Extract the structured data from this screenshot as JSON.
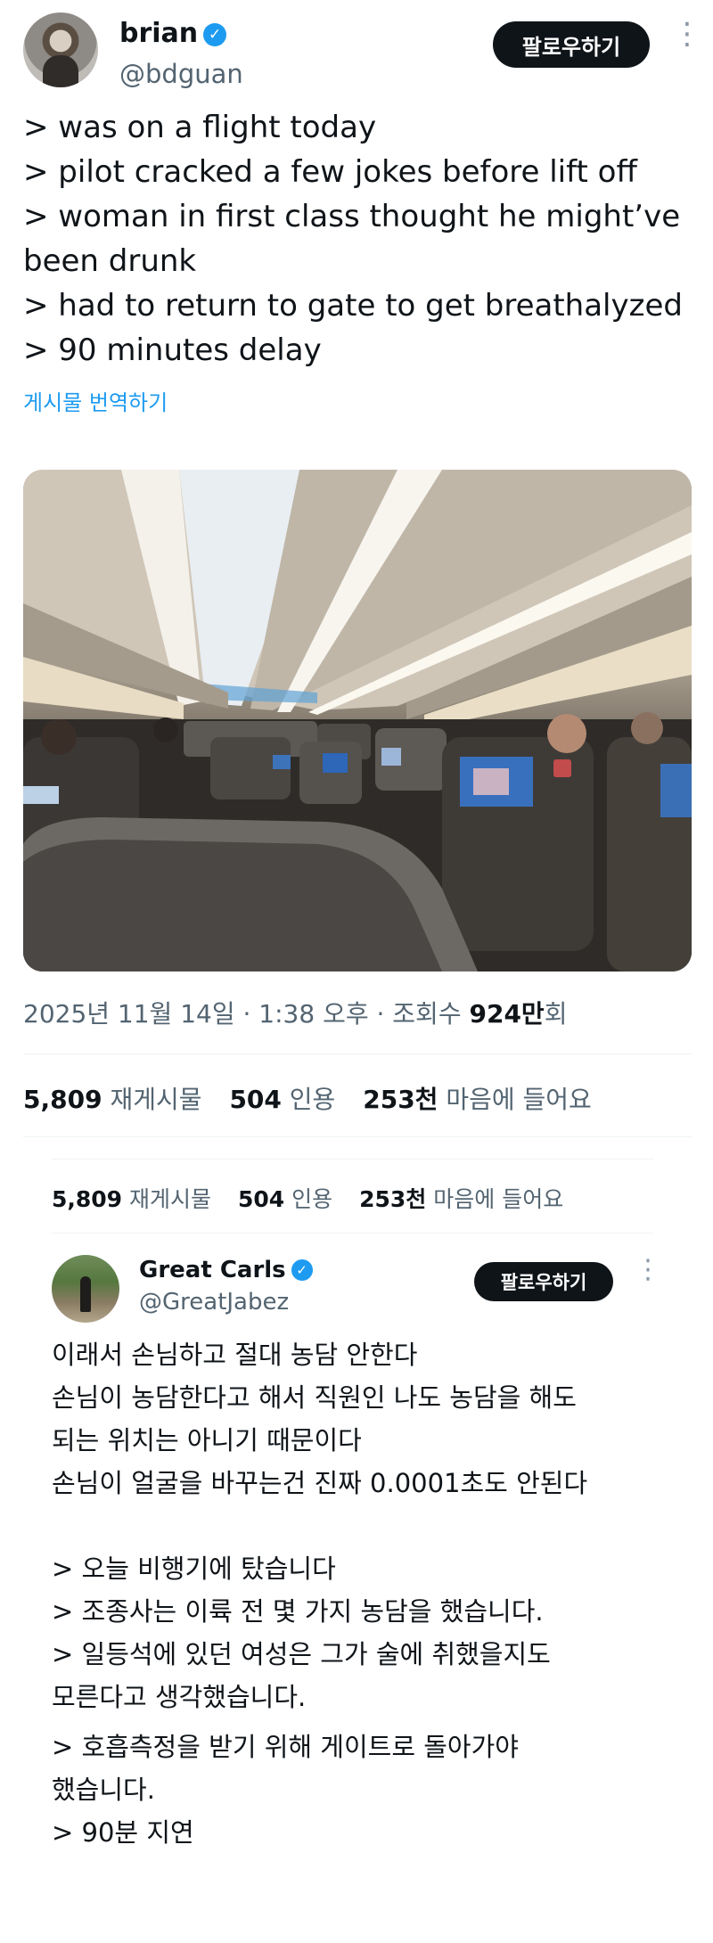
{
  "tweet1": {
    "author_name": "brian",
    "author_handle": "@bdguan",
    "follow_label": "팔로우하기",
    "more_icon": "⋮",
    "lines": [
      "> was on a flight today",
      "> pilot cracked a few jokes before lift off",
      "> woman in first class thought he might’ve been drunk",
      "> had to return to gate to get breathalyzed",
      "> 90 minutes delay"
    ],
    "translate_label": "게시물 번역하기",
    "meta": {
      "date": "2025년 11월 14일 · 1:38 오후 · 조회수 ",
      "views_value": "924만",
      "views_suffix": "회"
    },
    "stats": {
      "reposts_value": "5,809",
      "reposts_label": "재게시물",
      "quotes_value": "504",
      "quotes_label": "인용",
      "likes_value": "253천",
      "likes_label": "마음에 들어요"
    }
  },
  "quoted_stats": {
    "reposts_value": "5,809",
    "reposts_label": "재게시물",
    "quotes_value": "504",
    "quotes_label": "인용",
    "likes_value": "253천",
    "likes_label": "마음에 들어요"
  },
  "tweet2": {
    "author_name": "Great Carls",
    "author_handle": "@GreatJabez",
    "follow_label": "팔로우하기",
    "more_icon": "⋮",
    "paragraph1": [
      "이래서 손님하고 절대 농담 안한다",
      "손님이 농담한다고 해서 직원인 나도 농담을 해도",
      "되는 위치는 아니기 때문이다",
      "손님이 얼굴을 바꾸는건 진짜 0.0001초도 안된다"
    ],
    "paragraph2": [
      "> 오늘 비행기에 탔습니다",
      "> 조종사는 이륙 전 몇 가지 농담을 했습니다.",
      "> 일등석에 있던 여성은 그가 술에 취했을지도",
      "모른다고 생각했습니다."
    ],
    "paragraph3": [
      "> 호흡측정을 받기 위해 게이트로 돌아가야",
      "했습니다.",
      "> 90분 지연"
    ]
  },
  "icons": {
    "verified": "verified-badge-icon",
    "more": "more-options-icon"
  },
  "colors": {
    "accent": "#1d9bf0",
    "text": "#0f1419",
    "secondary": "#536471",
    "button": "#0f1419"
  }
}
